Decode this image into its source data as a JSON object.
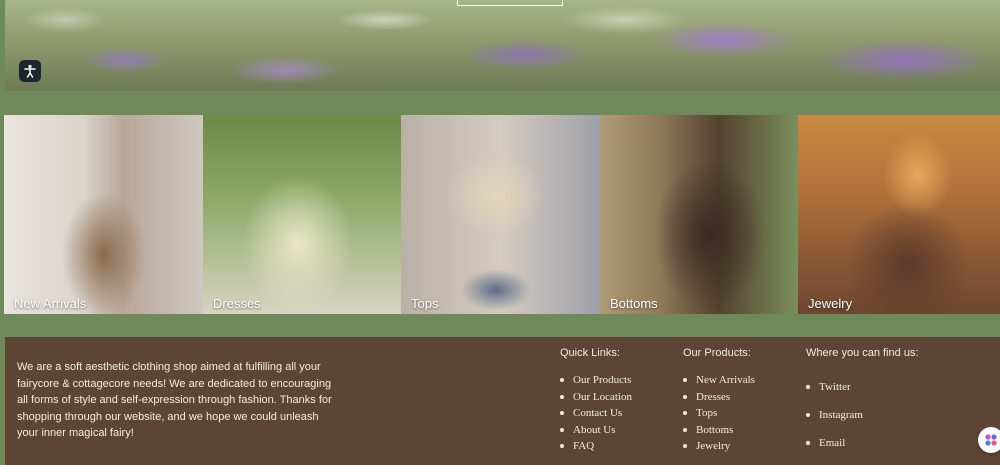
{
  "gallery": [
    {
      "label": "New Arrivals"
    },
    {
      "label": "Dresses"
    },
    {
      "label": "Tops"
    },
    {
      "label": "Bottoms"
    },
    {
      "label": "Jewelry"
    }
  ],
  "footer": {
    "about": "We are a soft aesthetic clothing shop aimed at fulfilling all your fairycore & cottagecore needs! We are dedicated to encouraging all forms of style and self-expression through fashion. Thanks for shopping through our website, and we hope we could unleash your inner magical fairy!",
    "quick_links": {
      "title": "Quick Links:",
      "items": [
        "Our Products",
        "Our Location",
        "Contact Us",
        "About Us",
        "FAQ"
      ]
    },
    "our_products": {
      "title": "Our Products:",
      "items": [
        "New Arrivals",
        "Dresses",
        "Tops",
        "Bottoms",
        "Jewelry"
      ]
    },
    "find_us": {
      "title": "Where you can find us:",
      "items": [
        "Twitter",
        "Instagram",
        "Email"
      ]
    }
  },
  "icons": {
    "accessibility": "accessibility-icon",
    "chat": "chat-widget-icon"
  },
  "colors": {
    "sage": "#6f8a5a",
    "footer_brown": "#5d4535",
    "footer_text": "#f2ece4"
  }
}
